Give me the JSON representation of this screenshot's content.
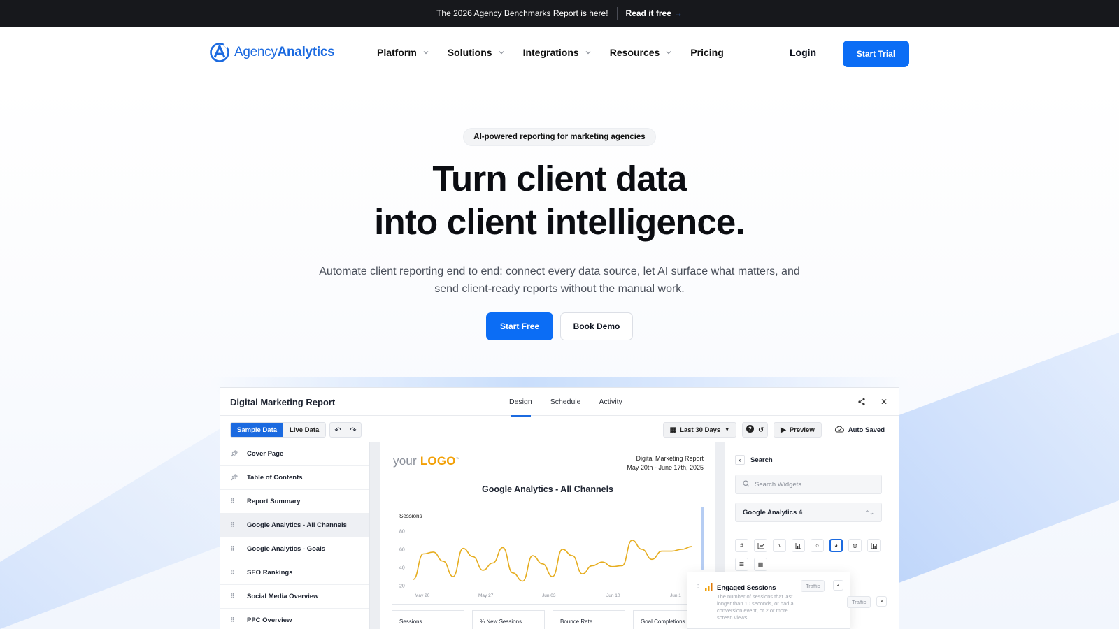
{
  "announcement": {
    "text": "The 2026 Agency Benchmarks Report is here!",
    "cta": "Read it free",
    "cta_icon": "arrow-right-icon"
  },
  "brand": {
    "name_light": "Agency",
    "name_bold": "Analytics",
    "accent_color": "#0b6df5"
  },
  "nav": {
    "items": [
      {
        "label": "Platform",
        "has_dropdown": true
      },
      {
        "label": "Solutions",
        "has_dropdown": true
      },
      {
        "label": "Integrations",
        "has_dropdown": true
      },
      {
        "label": "Resources",
        "has_dropdown": true
      },
      {
        "label": "Pricing",
        "has_dropdown": false
      }
    ],
    "login": "Login",
    "trial": "Start Trial"
  },
  "hero": {
    "pill": "AI-powered reporting for marketing agencies",
    "headline_line1": "Turn client data",
    "headline_line2": "into client intelligence.",
    "subtext": "Automate client reporting end to end: connect every data source, let AI surface what matters, and send client-ready reports without the manual work.",
    "primary_cta": "Start Free",
    "secondary_cta": "Book Demo"
  },
  "app": {
    "title": "Digital Marketing Report",
    "tabs": [
      {
        "label": "Design",
        "active": true
      },
      {
        "label": "Schedule",
        "active": false
      },
      {
        "label": "Activity",
        "active": false
      }
    ],
    "header_icons": [
      "share-icon",
      "close-icon"
    ],
    "toolbar": {
      "sample_data": "Sample Data",
      "live_data": "Live Data",
      "date_range": "Last 30 Days",
      "preview": "Preview",
      "auto_saved": "Auto Saved"
    },
    "sidebar": [
      {
        "label": "Cover Page",
        "pinned": true,
        "active": false
      },
      {
        "label": "Table of Contents",
        "pinned": true,
        "active": false
      },
      {
        "label": "Report Summary",
        "pinned": false,
        "active": false
      },
      {
        "label": "Google Analytics - All Channels",
        "pinned": false,
        "active": true
      },
      {
        "label": "Google Analytics - Goals",
        "pinned": false,
        "active": false
      },
      {
        "label": "SEO Rankings",
        "pinned": false,
        "active": false
      },
      {
        "label": "Social Media Overview",
        "pinned": false,
        "active": false
      },
      {
        "label": "PPC Overview",
        "pinned": false,
        "active": false
      }
    ],
    "page": {
      "logo_your": "your",
      "logo_word": "LOGO",
      "logo_tm": "™",
      "report_name": "Digital Marketing Report",
      "report_dates": "May 20th - June 17th, 2025",
      "section_title": "Google Analytics - All Channels",
      "metrics": [
        "Sessions",
        "% New Sessions",
        "Bounce Rate",
        "Goal Completions"
      ]
    },
    "right_panel": {
      "heading": "Search",
      "search_placeholder": "Search Widgets",
      "source": "Google Analytics 4",
      "widget_icons": [
        "hash-icon",
        "line-chart-icon",
        "sparkline-icon",
        "bar-chart-icon",
        "donut-icon",
        "pie-chart-icon",
        "globe-icon",
        "column-chart-icon",
        "stacked-bar-icon",
        "table-icon"
      ],
      "selected_widget": "pie-chart-icon"
    },
    "popover": {
      "title": "Engaged Sessions",
      "description": "The number of sessions that last longer than 10 seconds, or had a conversion event, or 2 or more screen views.",
      "tag": "Traffic"
    },
    "ghost_tag": "Traffic"
  },
  "chart_data": {
    "type": "line",
    "title": "Sessions",
    "x_ticks": [
      "May 20",
      "May 27",
      "Jun 03",
      "Jun 10",
      "Jun 1"
    ],
    "y_ticks": [
      20,
      40,
      60,
      80
    ],
    "ylim": [
      20,
      80
    ],
    "series": [
      {
        "color": "#e6ad1f",
        "values": [
          27,
          55,
          57,
          47,
          30,
          61,
          52,
          37,
          45,
          62,
          34,
          25,
          53,
          44,
          30,
          60,
          53,
          33,
          42,
          46,
          41,
          42,
          70,
          60,
          49,
          58,
          58,
          60,
          63
        ]
      }
    ],
    "grid": false,
    "legend": "none"
  }
}
